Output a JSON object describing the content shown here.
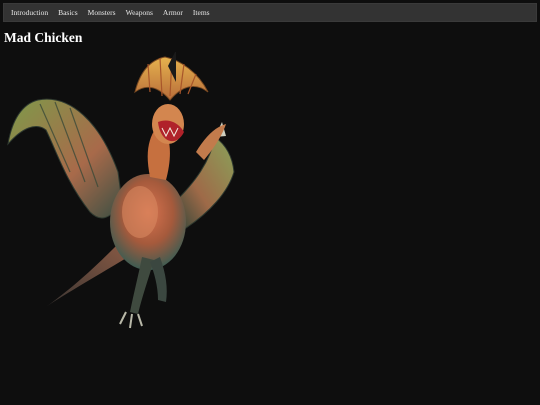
{
  "nav": {
    "items": [
      {
        "label": "Introduction"
      },
      {
        "label": "Basics"
      },
      {
        "label": "Monsters"
      },
      {
        "label": "Weapons"
      },
      {
        "label": "Armor"
      },
      {
        "label": "Items"
      }
    ]
  },
  "page": {
    "title": "Mad Chicken"
  },
  "image": {
    "subject": "monster-illustration"
  },
  "colors": {
    "background": "#0e0e0e",
    "navbar": "#333333",
    "nav_text": "#e8e8e8",
    "title_text": "#ffffff"
  }
}
